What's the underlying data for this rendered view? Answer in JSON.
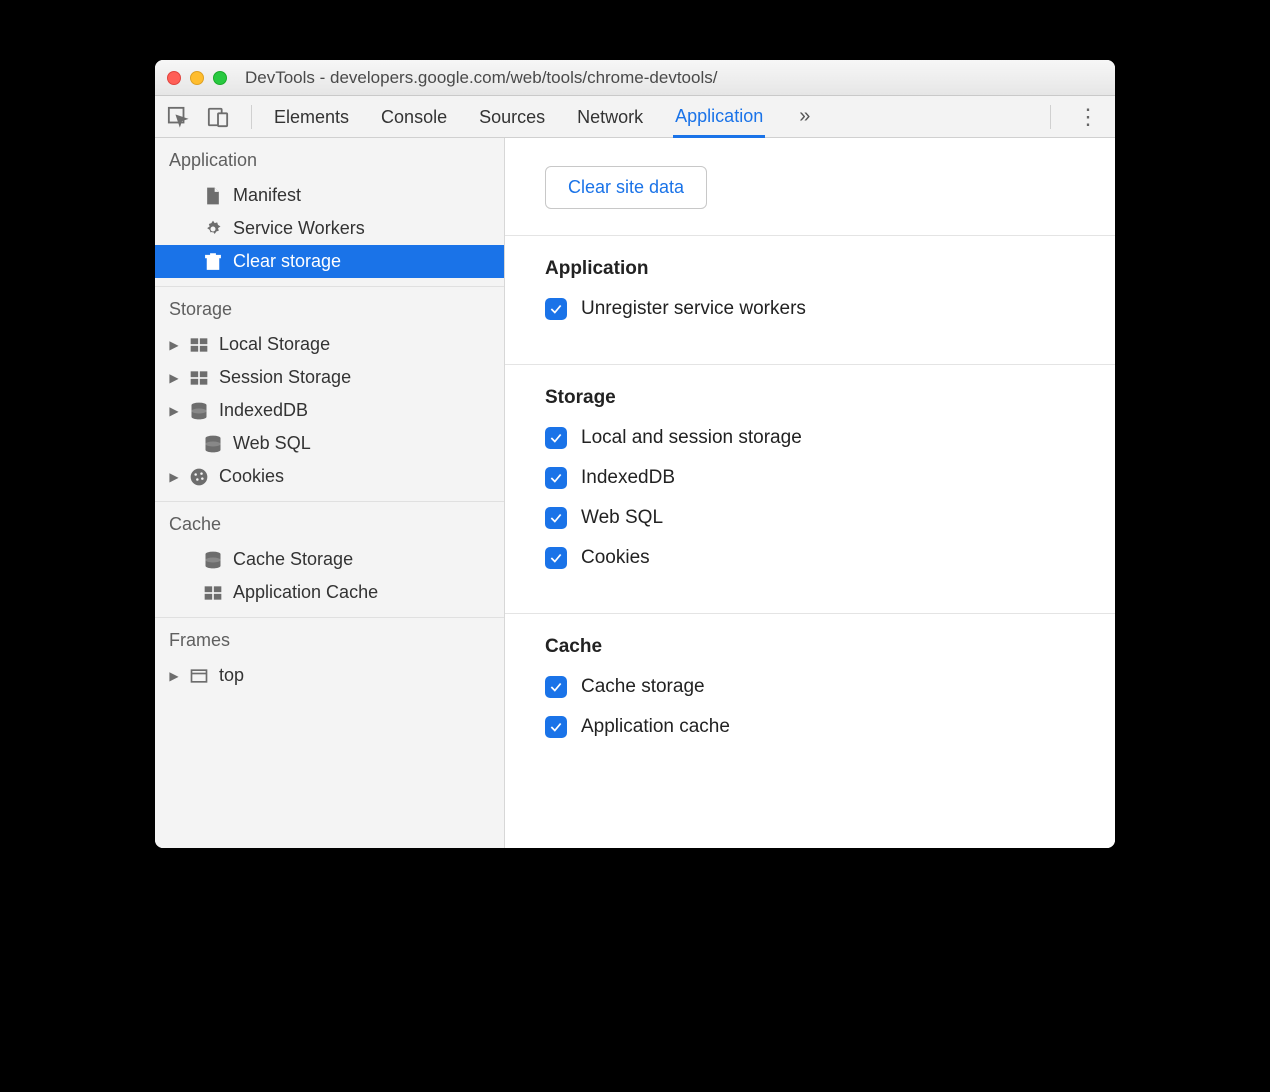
{
  "window": {
    "title": "DevTools - developers.google.com/web/tools/chrome-devtools/"
  },
  "toolbar": {
    "tabs": [
      "Elements",
      "Console",
      "Sources",
      "Network",
      "Application"
    ],
    "active_tab": "Application"
  },
  "sidebar": {
    "sections": [
      {
        "title": "Application",
        "items": [
          {
            "label": "Manifest",
            "icon": "file",
            "expandable": false
          },
          {
            "label": "Service Workers",
            "icon": "gear",
            "expandable": false
          },
          {
            "label": "Clear storage",
            "icon": "trash",
            "expandable": false,
            "selected": true
          }
        ]
      },
      {
        "title": "Storage",
        "items": [
          {
            "label": "Local Storage",
            "icon": "grid",
            "expandable": true
          },
          {
            "label": "Session Storage",
            "icon": "grid",
            "expandable": true
          },
          {
            "label": "IndexedDB",
            "icon": "db",
            "expandable": true
          },
          {
            "label": "Web SQL",
            "icon": "db",
            "expandable": false
          },
          {
            "label": "Cookies",
            "icon": "cookie",
            "expandable": true
          }
        ]
      },
      {
        "title": "Cache",
        "items": [
          {
            "label": "Cache Storage",
            "icon": "db",
            "expandable": false
          },
          {
            "label": "Application Cache",
            "icon": "grid",
            "expandable": false
          }
        ]
      },
      {
        "title": "Frames",
        "items": [
          {
            "label": "top",
            "icon": "frame",
            "expandable": true
          }
        ]
      }
    ]
  },
  "main": {
    "button": "Clear site data",
    "groups": [
      {
        "title": "Application",
        "checks": [
          {
            "label": "Unregister service workers",
            "checked": true
          }
        ]
      },
      {
        "title": "Storage",
        "checks": [
          {
            "label": "Local and session storage",
            "checked": true
          },
          {
            "label": "IndexedDB",
            "checked": true
          },
          {
            "label": "Web SQL",
            "checked": true
          },
          {
            "label": "Cookies",
            "checked": true
          }
        ]
      },
      {
        "title": "Cache",
        "checks": [
          {
            "label": "Cache storage",
            "checked": true
          },
          {
            "label": "Application cache",
            "checked": true
          }
        ]
      }
    ]
  }
}
